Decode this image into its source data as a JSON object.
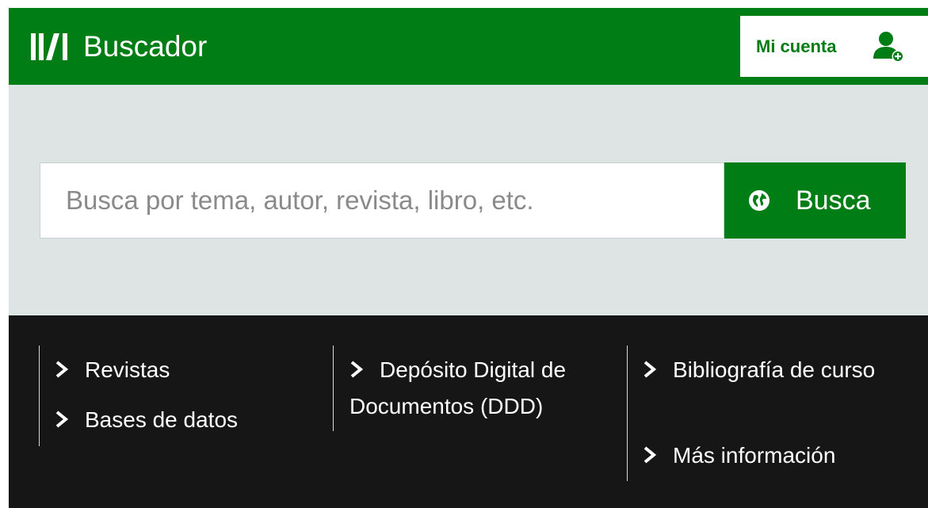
{
  "header": {
    "logo_text": "Buscador",
    "account_label": "Mi cuenta",
    "brand_color": "#007d14"
  },
  "search": {
    "placeholder": "Busca por tema, autor, revista, libro, etc.",
    "button_label": "Busca",
    "button_icon": "globe-icon"
  },
  "links": {
    "col1": [
      "Revistas",
      "Bases de datos"
    ],
    "col2": [
      "Depósito Digital de Documentos (DDD)"
    ],
    "col3": [
      "Bibliografía de curso",
      "Más información"
    ],
    "link_icon": "chevron-right-icon"
  }
}
